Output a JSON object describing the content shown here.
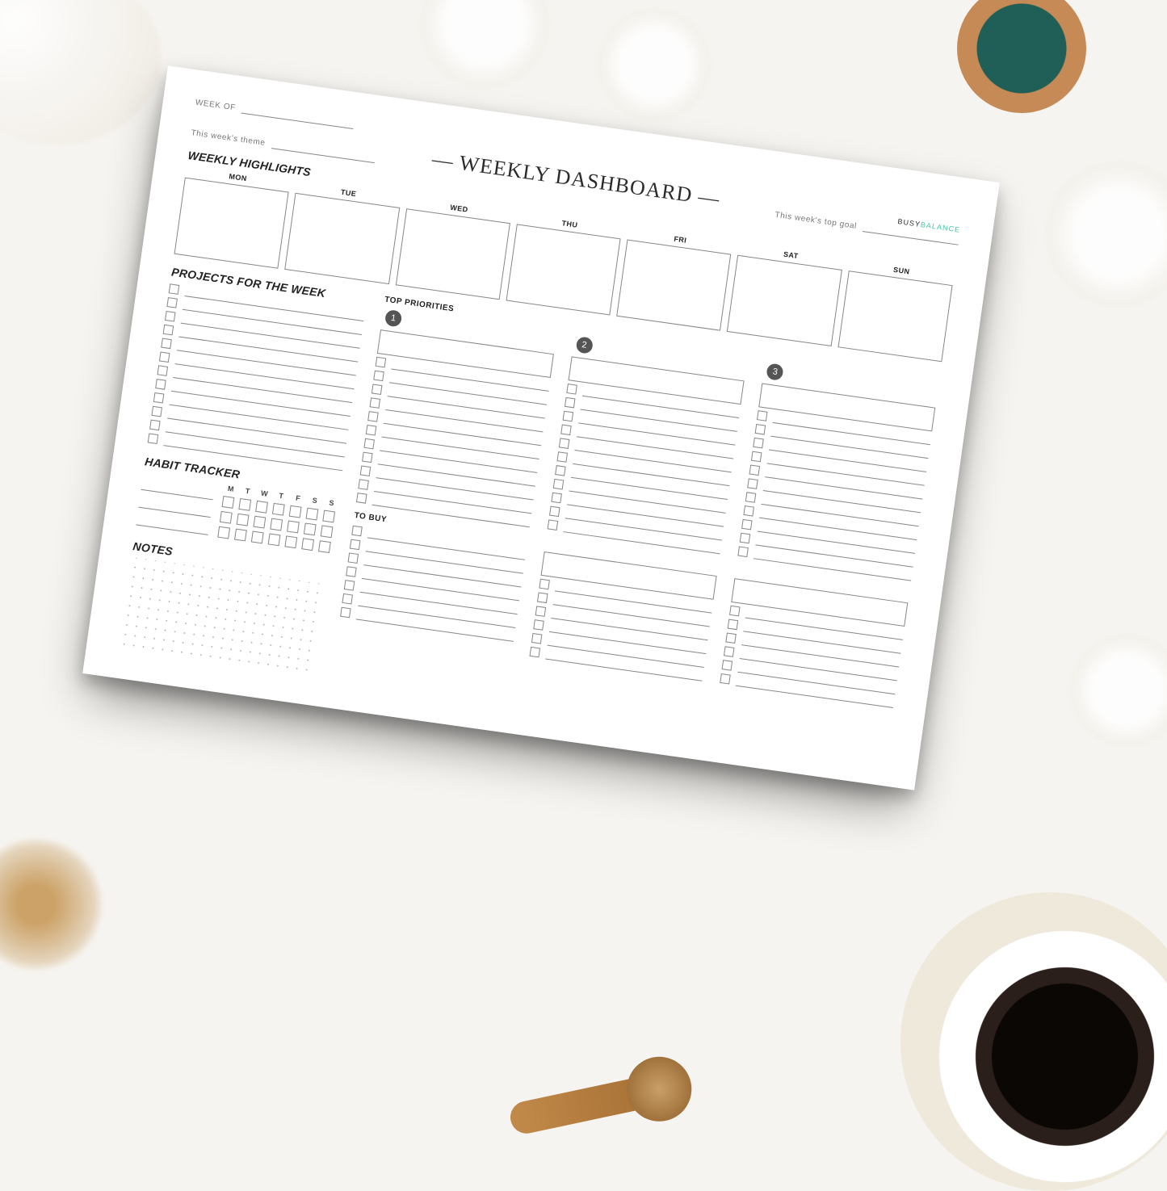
{
  "header": {
    "week_of_label": "WEEK OF",
    "theme_label": "This week's theme",
    "top_goal_label": "This week's top goal",
    "title": "— WEEKLY DASHBOARD —",
    "brand_a": "BUSY",
    "brand_b": "BALANCE"
  },
  "sections": {
    "highlights": "WEEKLY HIGHLIGHTS",
    "projects": "PROJECTS FOR THE WEEK",
    "top_priorities": "TOP PRIORITIES",
    "habit": "HABIT TRACKER",
    "notes": "NOTES",
    "to_buy": "TO BUY"
  },
  "days": [
    "MON",
    "TUE",
    "WED",
    "THU",
    "FRI",
    "SAT",
    "SUN"
  ],
  "habit_days": [
    "M",
    "T",
    "W",
    "T",
    "F",
    "S",
    "S"
  ],
  "priorities": [
    "1",
    "2",
    "3"
  ]
}
